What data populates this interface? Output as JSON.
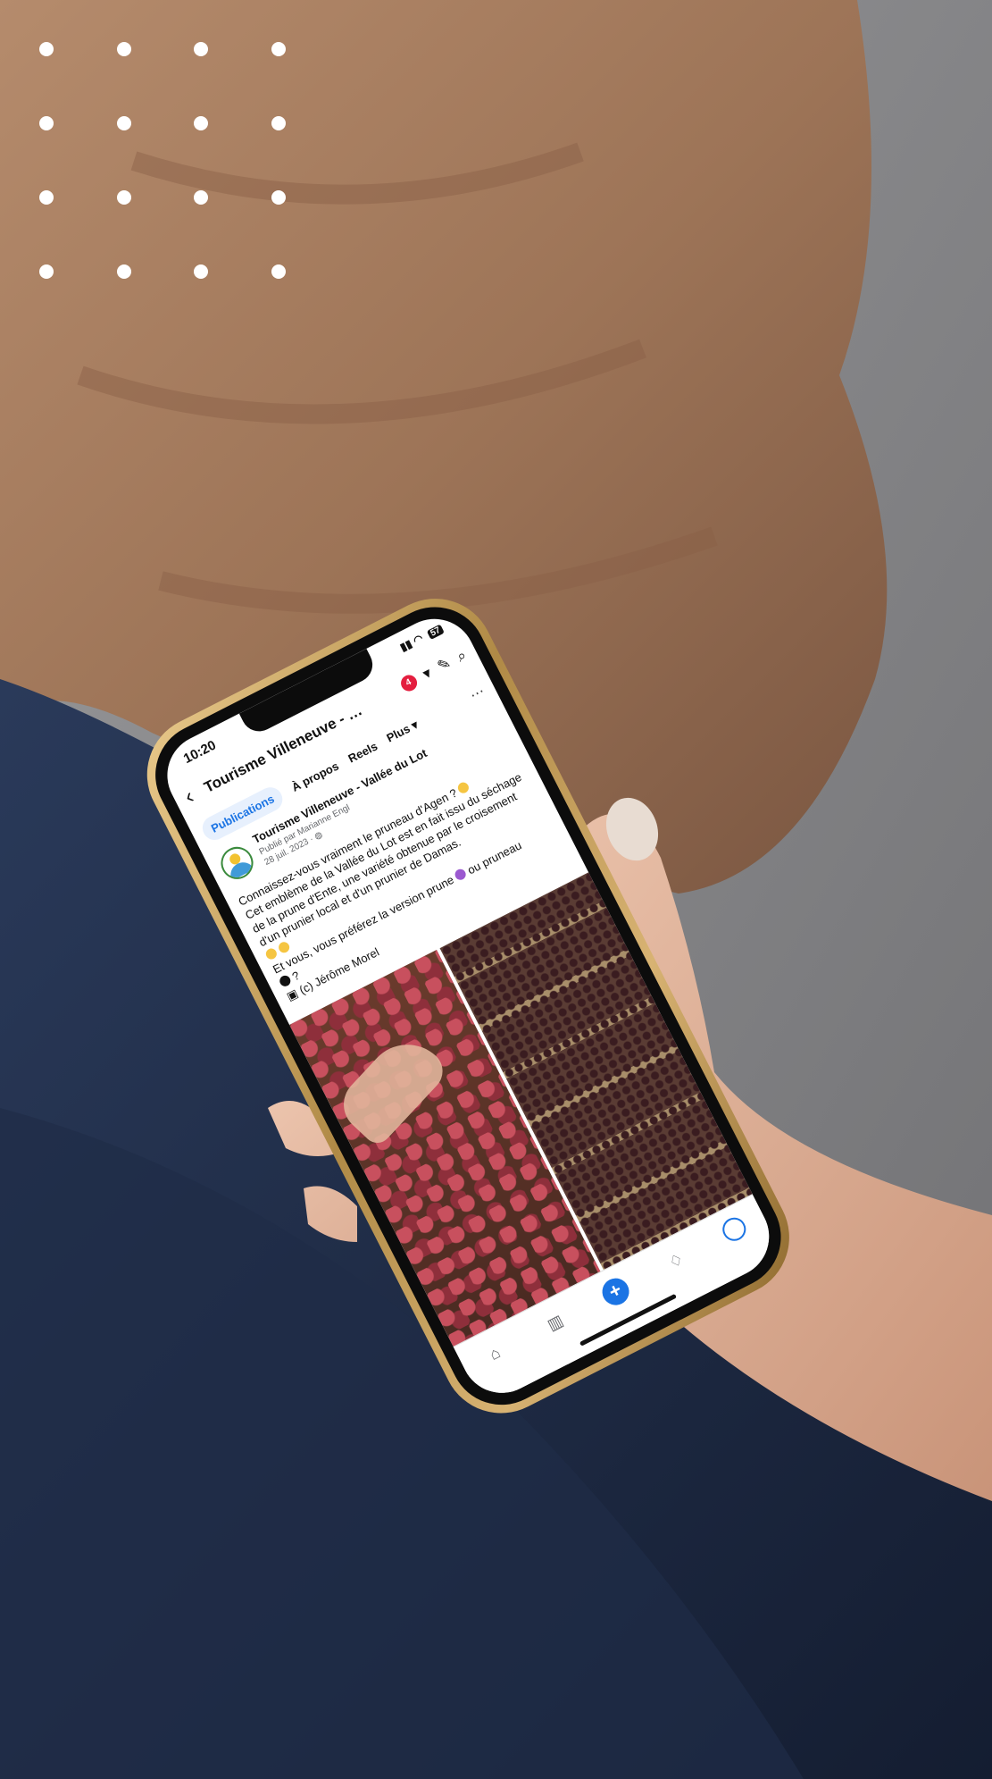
{
  "status": {
    "time": "10:20",
    "battery": "57"
  },
  "header": {
    "title": "Tourisme Villeneuve - Vallée...",
    "badge": "4"
  },
  "tabs": [
    "Publications",
    "À propos",
    "Reels",
    "Plus"
  ],
  "post": {
    "page_name": "Tourisme Villeneuve - Vallée du Lot",
    "published_by": "Publié par Marianne Engl",
    "date": "28 juil. 2023 ·",
    "text": [
      "Connaissez-vous vraiment le pruneau d'Agen ?",
      "Cet emblème de la Vallée du Lot est en fait issu du séchage de la prune d'Ente, une variété obtenue par le croisement d'un prunier local et d'un prunier de Damas.",
      "Et vous, vous préférez la version prune",
      "ou pruneau",
      "?"
    ],
    "credit": "(c) Jérôme Morel"
  },
  "colors": {
    "accent": "#1b74e4",
    "badge": "#e41e3f",
    "phone_frame": "#c9a35f"
  },
  "icons": [
    "back-icon",
    "pencil-icon",
    "search-icon",
    "more-icon",
    "home-icon",
    "dashboard-icon",
    "plus-icon",
    "bell-icon"
  ]
}
